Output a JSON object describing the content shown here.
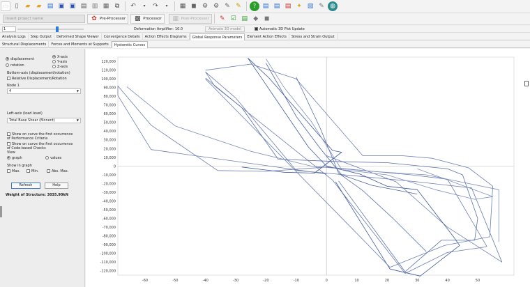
{
  "toolbar2": {
    "project_placeholder": "Insert project name",
    "preprocessor_label": "Pre-Processor",
    "processor_label": "Processor",
    "postprocessor_label": "Post-Processor"
  },
  "toolbar3": {
    "step_value": "1",
    "deformation_label": "Deformation Amplifier:",
    "deformation_value": "10.0",
    "animate_label": "Animate 3D model",
    "auto_plot_label": "Automatic 3D Plot Update",
    "auto_plot_checked": true
  },
  "tabs1": [
    {
      "label": "Analysis Logs"
    },
    {
      "label": "Step Output"
    },
    {
      "label": "Deformed Shape Viewer"
    },
    {
      "label": "Convergence Details"
    },
    {
      "label": "Action Effects Diagrams"
    },
    {
      "label": "Global Response Parameters",
      "active": true
    },
    {
      "label": "Element Action Effects"
    },
    {
      "label": "Stress and Strain Output"
    }
  ],
  "tabs2": [
    {
      "label": "Structural Displacements"
    },
    {
      "label": "Forces and Moments at Supports"
    },
    {
      "label": "Hysteretic Curves",
      "active": true
    }
  ],
  "panel": {
    "displacement": "displacement",
    "rotation": "rotation",
    "xaxis": "X-axis",
    "yaxis": "Y-axis",
    "zaxis": "Z-axis",
    "bottom_axis_label": "Bottom-axis (displacement/rotation)",
    "relative_label": "Relative Displacement/Rotation",
    "node_label": "Node 1",
    "node_value": "4",
    "left_axis_label": "Left-axis (load level)",
    "left_axis_value": "Total Base Shear (Monent)",
    "first_occurrence_perf": "Show on curve the first occurrence of Performance Criteria",
    "first_occurrence_code": "Show on curve the first occurrence of Code-based Checks",
    "view_label": "View",
    "graph_label": "graph",
    "values_label": "values",
    "show_in_graph_label": "Show in graph",
    "max_label": "Max.",
    "min_label": "Min.",
    "absmax_label": "Abs. Max.",
    "refresh_label": "Refresh",
    "help_label": "Help",
    "weight_label": "Weight of Structure: 3035.90kN"
  },
  "chart_data": {
    "type": "line",
    "title": "",
    "xlabel": "",
    "ylabel": "",
    "xlim": [
      -69,
      62
    ],
    "ylim": [
      -125,
      125
    ],
    "xticks": [
      -60,
      -50,
      -40,
      -30,
      -20,
      -10,
      0,
      10,
      20,
      30,
      40,
      50
    ],
    "yticks": [
      120,
      110,
      100,
      90,
      80,
      70,
      60,
      50,
      40,
      30,
      20,
      10,
      0,
      -10,
      -20,
      -30,
      -40,
      -50,
      -60,
      -70,
      -80,
      -90,
      -100,
      -110,
      -120
    ],
    "ytick_labels": [
      "120,000",
      "110,000",
      "100,000",
      "90,000",
      "80,000",
      "70,000",
      "60,000",
      "50,000",
      "40,000",
      "30,000",
      "20,000",
      "10,000",
      "0",
      "-10,000",
      "-20,000",
      "-30,000",
      "-40,000",
      "-50,000",
      "-60,000",
      "-70,000",
      "-80,000",
      "-90,000",
      "-100,000",
      "-110,000",
      "-120,000"
    ],
    "grid": true,
    "series": [
      {
        "x": [
          0,
          -58,
          -58,
          -69,
          -69,
          -58,
          -36,
          -20,
          0,
          28,
          40,
          53,
          52,
          40,
          26,
          2,
          -37,
          -40,
          -30,
          -10,
          0,
          30,
          48,
          58,
          58,
          40,
          23,
          0
        ],
        "values": [
          -9,
          19,
          19,
          81,
          92,
          47,
          -5,
          -6,
          -1,
          -10,
          -15,
          -92,
          -93,
          -99,
          -123,
          -16,
          92,
          108,
          78,
          -5,
          -8,
          -18,
          -25,
          -110,
          -110,
          -70,
          -18,
          12
        ]
      },
      {
        "x": [
          -40,
          -28,
          -16,
          5,
          20,
          40,
          45,
          50,
          49,
          38,
          26,
          4
        ],
        "values": [
          101,
          67,
          8,
          5,
          4,
          -3,
          -10,
          -60,
          -85,
          -85,
          -121,
          -17
        ]
      },
      {
        "x": [
          -28,
          -14,
          -4,
          5,
          2,
          -19,
          -26,
          -6,
          0,
          11,
          20,
          30,
          42,
          44,
          31,
          21,
          3
        ],
        "values": [
          -1,
          -7,
          -8,
          16,
          18,
          101,
          124,
          22,
          0,
          -9,
          -23,
          -27,
          -81,
          -91,
          -126,
          -118,
          -18
        ]
      },
      {
        "x": [
          -40,
          -25,
          -10,
          12,
          25,
          35,
          47,
          55,
          54,
          39,
          21,
          -40
        ],
        "values": [
          110,
          117,
          100,
          12,
          12,
          9,
          -2,
          -23,
          -81,
          -91,
          -116,
          100
        ]
      },
      {
        "x": [
          -20,
          -14,
          -5,
          5,
          20,
          36,
          49,
          55,
          30
        ],
        "values": [
          123,
          90,
          51,
          -4,
          -10,
          -27,
          -38,
          -35,
          -3
        ]
      },
      {
        "x": [
          -66,
          -50,
          -25,
          -5,
          15,
          33,
          57,
          57
        ],
        "values": [
          91,
          46,
          17,
          0,
          -6,
          -10,
          -27,
          -87
        ]
      },
      {
        "x": [
          -20,
          -10,
          -2,
          5,
          15,
          30
        ],
        "values": [
          118,
          57,
          20,
          -10,
          -22,
          -32
        ]
      },
      {
        "x": [
          -10,
          -2,
          4,
          12,
          22,
          33
        ],
        "values": [
          102,
          43,
          -8,
          -28,
          -60,
          -98
        ]
      }
    ]
  }
}
